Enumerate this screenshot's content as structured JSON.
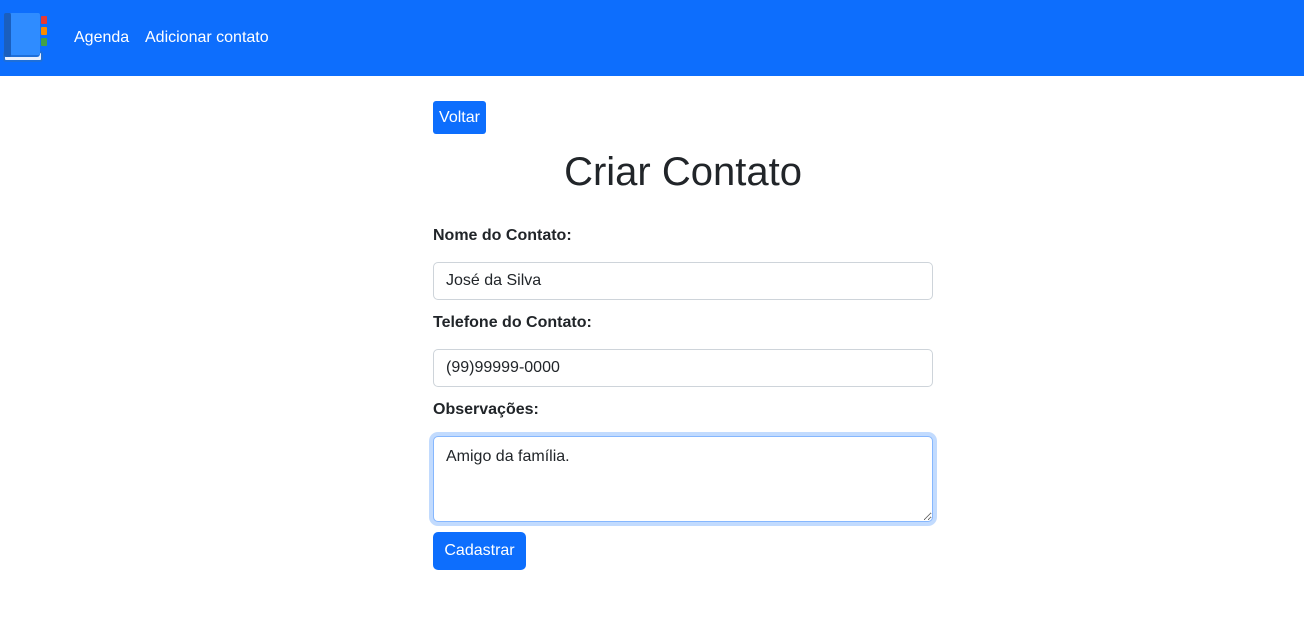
{
  "nav": {
    "logo_icon": "address-book-icon",
    "links": [
      {
        "label": "Agenda"
      },
      {
        "label": "Adicionar contato"
      }
    ],
    "background_color": "#0d6efd"
  },
  "main": {
    "back_button_label": "Voltar",
    "title": "Criar Contato",
    "form": {
      "name": {
        "label": "Nome do Contato:",
        "value": "José da Silva"
      },
      "phone": {
        "label": "Telefone do Contato:",
        "value": "(99)99999-0000"
      },
      "notes": {
        "label": "Observações:",
        "value": "Amigo da família."
      },
      "submit_label": "Cadastrar"
    }
  },
  "colors": {
    "primary": "#0d6efd",
    "text": "#212529",
    "input_border": "#ced4da",
    "focus_border": "#86b7fe"
  }
}
